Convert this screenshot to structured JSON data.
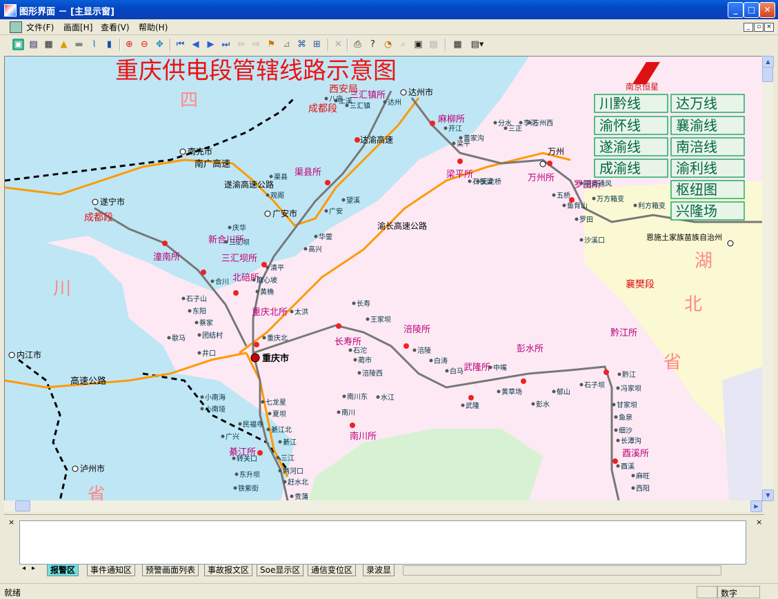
{
  "window": {
    "title": "图形界面 － [主显示窗]"
  },
  "menu": [
    "文件(F)",
    "画面[H]",
    "查看(V)",
    "帮助(H)"
  ],
  "map": {
    "title": "重庆供电段管辖线路示意图",
    "logo_text": "南京恒星",
    "legend": [
      "川黔线",
      "达万线",
      "渝怀线",
      "襄渝线",
      "遂渝线",
      "南涪线",
      "成渝线",
      "渝利线",
      "枢纽图",
      "兴隆场"
    ],
    "province_labels": [
      "四",
      "川",
      "省",
      "湖",
      "北",
      "省"
    ],
    "city_labels": [
      "达州市",
      "南充市",
      "遂宁市",
      "广安市",
      "重庆市",
      "内江市",
      "泸州市",
      "万州",
      "恩施土家族苗族自治州"
    ],
    "bureau_labels": [
      "西安局",
      "成都段",
      "成都段",
      "襄樊段"
    ],
    "substation_labels": [
      "麻柳所",
      "渠县所",
      "梁平所",
      "万州所",
      "罗田所",
      "潼南所",
      "新合川所",
      "三汇坝所",
      "北碚所",
      "重庆北所",
      "长寿所",
      "涪陵所",
      "武隆所",
      "彭水所",
      "黔江所",
      "南川所",
      "綦江所",
      "三汇镇所",
      "酉溪所"
    ],
    "highway_labels": [
      "南广高速",
      "遂渝高速公路",
      "达渝高速",
      "渝长高速公路",
      "高速公路"
    ],
    "station_labels": [
      "达州",
      "三汇镇",
      "土溪",
      "八庙",
      "渠县",
      "观阁",
      "望溪",
      "广安",
      "华蓥",
      "高兴",
      "庆华",
      "三汇坝",
      "清平",
      "磨心坡",
      "黄桷",
      "合川",
      "石子山",
      "东阳",
      "蔡家",
      "团结村",
      "歇马",
      "井口",
      "重庆北",
      "太洪",
      "长寿",
      "王家坝",
      "石沱",
      "蔺市",
      "涪陵西",
      "涪陵",
      "白涛",
      "白马",
      "武隆",
      "中嘴",
      "黄草场",
      "彭水",
      "郁山",
      "石子坝",
      "黔江",
      "冯家坝",
      "甘家坝",
      "鱼泉",
      "细沙",
      "长潭沟",
      "酉溪",
      "麻旺",
      "西阳",
      "南川",
      "南川东",
      "水江",
      "小南海",
      "小南垭",
      "七龙星",
      "夏坝",
      "民福寺",
      "綦江北",
      "广兴",
      "綦江",
      "转关口",
      "三江",
      "东升坝",
      "两河口",
      "赶水北",
      "铁紫街",
      "贵蒲",
      "开江",
      "梁平",
      "黄家沟",
      "石板梁",
      "天龙桥",
      "分水",
      "三正",
      "李河",
      "万州西",
      "五桥",
      "鱼背山",
      "罗田",
      "隧道通风",
      "万方箱变",
      "利方箱变",
      "沙溪口"
    ]
  },
  "output_tabs": [
    "报警区",
    "事件通知区",
    "预警画面列表",
    "事故报文区",
    "Soe显示区",
    "通信变位区",
    "录波显"
  ],
  "status": {
    "left": "就绪",
    "mode": "数字"
  }
}
